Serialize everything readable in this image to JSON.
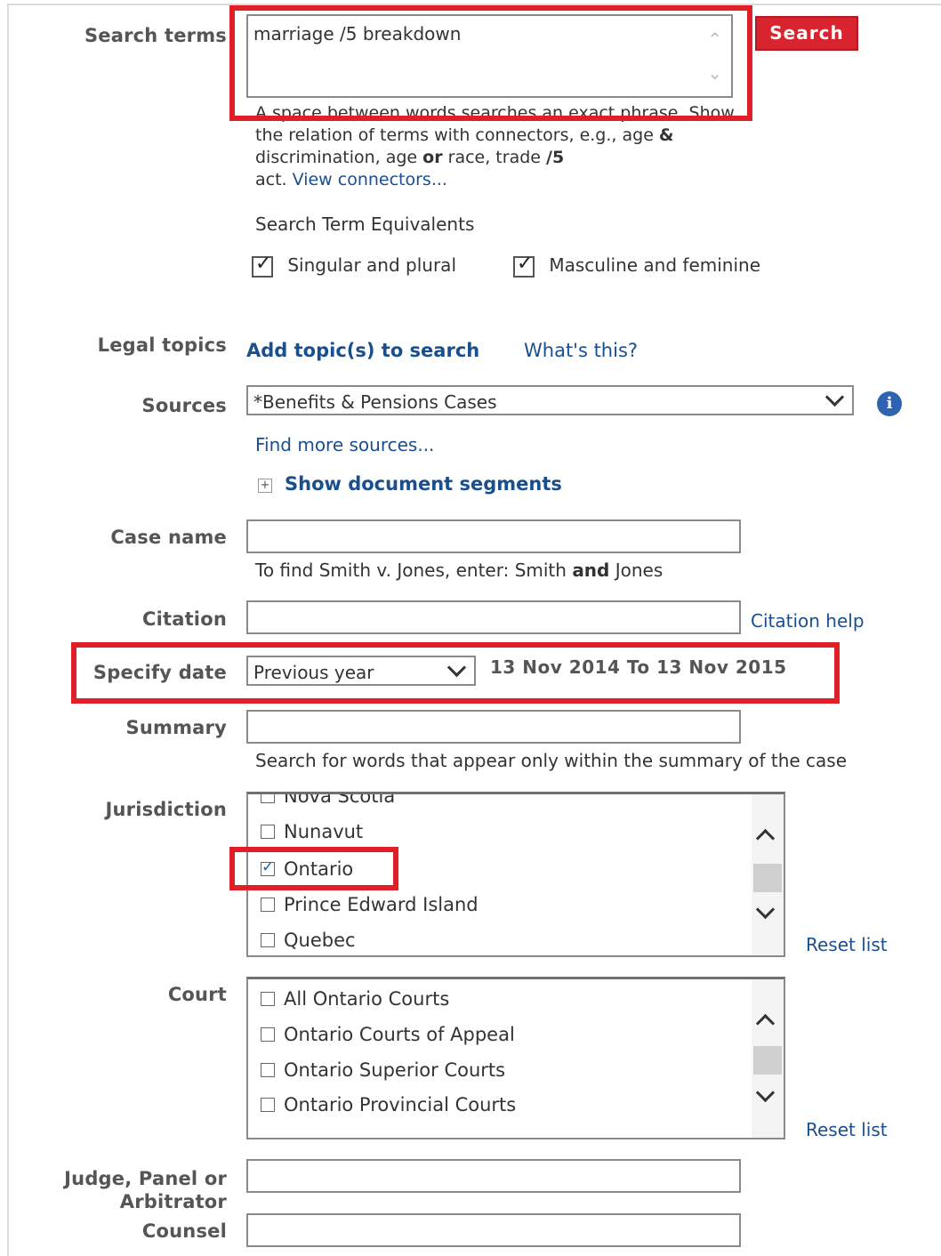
{
  "search_terms": {
    "label": "Search terms",
    "value": "marriage /5 breakdown",
    "button": "Search",
    "hint_line1": "A space between words searches an exact phrase. Show",
    "hint_line2_a": "the relation of terms with connectors, e.g., age ",
    "hint_line2_b": "&",
    "hint_line3_a": "discrimination, age ",
    "hint_line3_b": "or",
    "hint_line3_c": " race, trade ",
    "hint_line3_d": "/5",
    "hint_line4_a": "act. ",
    "hint_line4_link": "View connectors...",
    "equivalents_title": "Search Term Equivalents",
    "singular_plural": "Singular and plural",
    "masculine_feminine": "Masculine and feminine"
  },
  "legal_topics": {
    "label": "Legal topics",
    "add_link": "Add topic(s) to search",
    "whats_this": "What's this?"
  },
  "sources": {
    "label": "Sources",
    "selected": "*Benefits & Pensions Cases",
    "find_more": "Find more sources...",
    "show_segments": "Show document segments"
  },
  "case_name": {
    "label": "Case name",
    "hint_a": "To find Smith v. Jones, enter: Smith ",
    "hint_b": "and",
    "hint_c": " Jones"
  },
  "citation": {
    "label": "Citation",
    "help": "Citation help"
  },
  "specify_date": {
    "label": "Specify date",
    "selected": "Previous year",
    "range": "13 Nov 2014 To 13 Nov 2015"
  },
  "summary": {
    "label": "Summary",
    "hint": "Search for words that appear only within the summary of the case"
  },
  "jurisdiction": {
    "label": "Jurisdiction",
    "items": [
      "Nova Scotia",
      "Nunavut",
      "Ontario",
      "Prince Edward Island",
      "Quebec"
    ],
    "checked": [
      "Ontario"
    ],
    "reset": "Reset list"
  },
  "court": {
    "label": "Court",
    "items": [
      "All Ontario Courts",
      "Ontario Courts of Appeal",
      "Ontario Superior Courts",
      "Ontario Provincial Courts"
    ],
    "reset": "Reset list"
  },
  "judge": {
    "label_line1": "Judge, Panel or",
    "label_line2": "Arbitrator"
  },
  "counsel": {
    "label": "Counsel"
  },
  "colors": {
    "highlight": "#e01f26",
    "link": "#1a4f8f",
    "search_button": "#d9232e"
  }
}
